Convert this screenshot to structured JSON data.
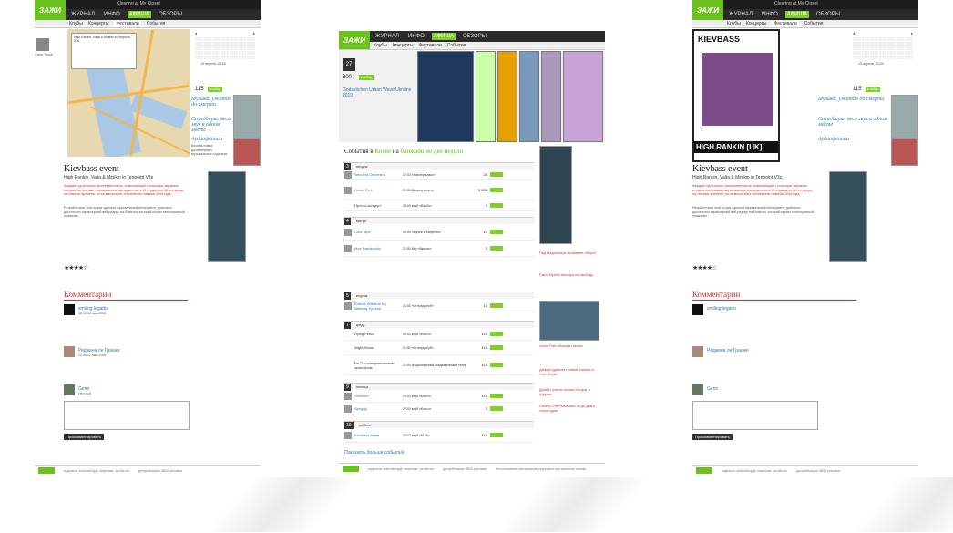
{
  "nav": {
    "items": [
      "ЖУРНАЛ",
      "ИНФО",
      "АФИША",
      "ОБЗОРЫ"
    ],
    "active": "АФИША"
  },
  "subnav": {
    "items": [
      "Клубы",
      "Концерты",
      "Фестивали",
      "События"
    ],
    "active": "Фестивали"
  },
  "user": {
    "top_label": "Clearing at My Closet",
    "name": "Стинг Ярый"
  },
  "logo_text": "ЗАЖИ",
  "event": {
    "title": "Kievbass event",
    "subtitle": "High Rankin, Valta & Minikin in Tenpoint V3s",
    "date_text": "15 апреля, 23:00",
    "price": "115",
    "buy_label": "в побор",
    "poster_title": "HIGH RANKIN [UK]",
    "poster_brand": "KIEVBASS",
    "lead": "Каждый год успешно экспериментатор, позволяющий с помощью звучания, которая настраивает музыкальные инструменты, в 18 студиях их 26 эта вроде, на станции времени, но ни масштабах технических новинок 2008 года.",
    "body": "Разработчики этой штуки сделали музыкальный инструмент, довольно достаточно характерный веб-радиус на Rostrum, который играет многогранный гуманизм."
  },
  "sidebar": {
    "news": [
      {
        "title": "Музыка, ужатая до смерти",
        "text": "Американцы, третьи после..."
      },
      {
        "title": "Саундбары: весь звук в одном месте",
        "text": "На нас смотрели ещё с ёлки..."
      },
      {
        "title": "Аудиофетиш",
        "text": "Восемь новых дизайнерских музыкальных подарков"
      }
    ]
  },
  "comments": {
    "heading": "Комментарии",
    "items": [
      {
        "name": "smiling legatto",
        "date": "12:05 12 мая 2008"
      },
      {
        "name": "Реджина ле Гранже",
        "date": "12:05 12 мая 2008"
      },
      {
        "name": "Genn",
        "date": "(это ты!)"
      }
    ],
    "submit_label": "Прокомментировать"
  },
  "footer": {
    "col1": "издатель: kultorskeng@ лицензия: ya-site.ws",
    "col2": "дистрибьюция: 8800 реклама",
    "col3": "Использование материалов разрешено при указании ссылки"
  },
  "listing": {
    "heading_prefix": "События в",
    "city": "Киеве",
    "heading_mid": "на",
    "period": "ближайшие две недели",
    "featured_day": "27",
    "featured_price": "300",
    "featured_name": "Godskitchen Urban Wave Ukraine 2010",
    "days": [
      {
        "num": "3",
        "label": "сегодня",
        "events": [
          {
            "name": "New Era Orchestra",
            "venue": "17:00 «Мастер класс»",
            "price": "20"
          },
          {
            "name": "Linkin Park",
            "venue": "21:00 Дворец спорта",
            "price": "5 836"
          },
          {
            "name": "Просто концерт",
            "venue": "23:00 клуб «Барбо»",
            "price": "3"
          }
        ]
      },
      {
        "num": "4",
        "label": "завтра",
        "events": [
          {
            "name": "Chill-Tape",
            "venue": "20:00 «Музеи в Капустах»",
            "price": "10"
          },
          {
            "name": "Max Pashkovski",
            "venue": "21:00 бар «Вкусно»",
            "price": "3"
          }
        ]
      },
      {
        "num": "5",
        "label": "вторник",
        "events": [
          {
            "name": "Robbie Williams My Birthday Special",
            "venue": "21:00 «Оглоед клуб»",
            "price": "10"
          }
        ]
      },
      {
        "num": "7",
        "label": "среда",
        "events": [
          {
            "name": "Dying Fetus",
            "venue": "20:00 клуб «Бинго»",
            "price": "115"
          },
          {
            "name": "Night Music",
            "venue": "21:00 «Оглоед клуб»",
            "price": "115"
          },
          {
            "name": "Ва-О с симфоническим оркестром",
            "venue": "21:00 Национальный академический театр",
            "price": "115"
          }
        ]
      },
      {
        "num": "9",
        "label": "пятница",
        "events": [
          {
            "name": "Sunvoxu",
            "venue": "20:00 клуб «Бинго»",
            "price": "115"
          },
          {
            "name": "Sangaji",
            "venue": "22:00 клуб «Бинго»",
            "price": "3"
          }
        ]
      },
      {
        "num": "10",
        "label": "суббота",
        "events": [
          {
            "name": "Kievbass event",
            "venue": "23:00 клуб «КЦЛ»",
            "price": "115"
          }
        ]
      }
    ],
    "more_label": "Показать больше событий",
    "right_news": [
      "Под Мадагаскра проживает оборот",
      "Faton Myellel выходит на свободу",
      "Linkin Park обещают вызов",
      "Даффи удивляет новый альбом в Нью-Йорке",
      "Дизайн группы Invideo на круг в Африке",
      "Сигаль Стен началась на до дам в телестудии"
    ]
  },
  "colors": {
    "accent": "#7fcf24",
    "link": "#2a7bb8",
    "highlight": "#cc3333",
    "header": "#2a2a2a"
  }
}
